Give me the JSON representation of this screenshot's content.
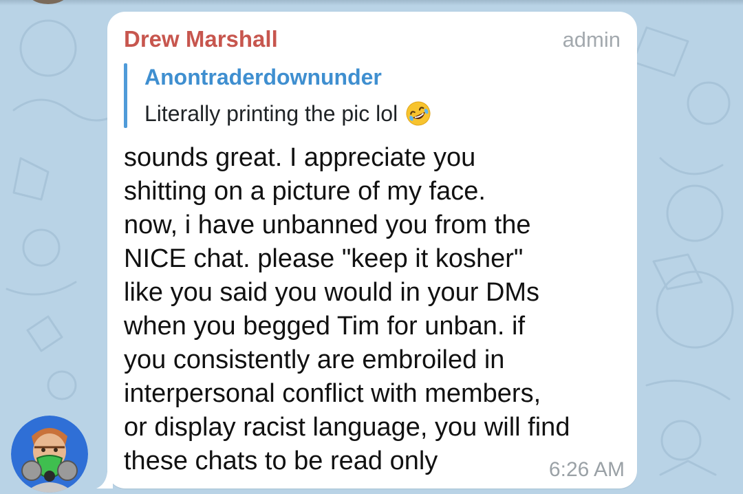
{
  "message": {
    "sender_name": "Drew Marshall",
    "role_badge": "admin",
    "reply": {
      "author": "Anontraderdownunder",
      "text": "Literally printing the pic lol",
      "emoji_icon": "rofl-emoji-icon"
    },
    "body_lines": [
      "sounds great. I appreciate you",
      "shitting on a picture of my face.",
      "now, i have unbanned you from the",
      "NICE chat. please \"keep it kosher\"",
      "like you said you would in your DMs",
      "when you begged Tim for unban. if",
      "you consistently are embroiled in",
      "interpersonal conflict with members,",
      "or display racist language, you will find",
      "these chats to be read only"
    ],
    "time": "6:26 AM"
  },
  "colors": {
    "sender_name": "#c7564e",
    "reply_accent": "#4f9bd9",
    "bubble": "#ffffff",
    "wallpaper": "#b9d3e6"
  },
  "icons": {
    "avatar": "user-avatar-gas-mask",
    "wallpaper": "doodle-pattern"
  }
}
